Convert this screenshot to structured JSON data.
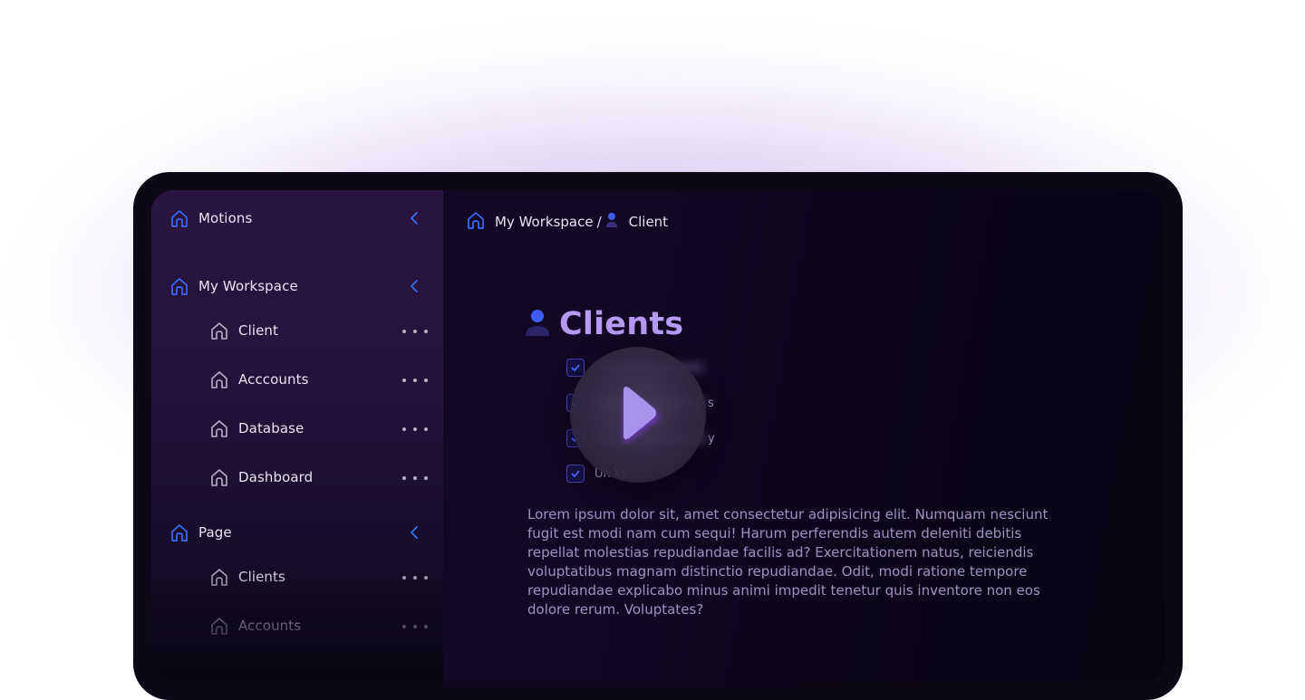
{
  "sidebar": {
    "motions": {
      "label": "Motions"
    },
    "workspace": {
      "label": "My Workspace",
      "items": [
        {
          "label": "Client"
        },
        {
          "label": "Acccounts"
        },
        {
          "label": "Database"
        },
        {
          "label": "Dashboard"
        }
      ]
    },
    "page": {
      "label": "Page",
      "items": [
        {
          "label": "Clients"
        },
        {
          "label": "Accounts"
        }
      ]
    }
  },
  "breadcrumb": {
    "workspace": "My Workspace",
    "separator": "/",
    "current": "Client"
  },
  "main": {
    "title": "Clients",
    "checklist": [
      {
        "label": "",
        "checked": true
      },
      {
        "label": "s",
        "checked": true
      },
      {
        "label": "y",
        "checked": true
      },
      {
        "label": "Un  ks",
        "checked": true
      }
    ],
    "paragraph": "Lorem ipsum dolor sit, amet consectetur adipisicing elit. Numquam nesciunt fugit est modi nam cum sequi! Harum perferendis autem deleniti debitis repellat molestias repudiandae facilis ad? Exercitationem natus, reiciendis voluptatibus magnam distinctio repudiandae. Odit, modi ratione tempore repudiandae explicabo minus animi impedit tenetur quis inventore non eos dolore rerum. Voluptates?"
  },
  "colors": {
    "accent_blue": "#3a6cf5",
    "title_purple": "#b59af0",
    "play_purple": "#a893ec"
  },
  "icons": [
    "house-icon",
    "chevron-left-icon",
    "more-dots-icon",
    "user-icon",
    "checkbox-icon",
    "play-icon"
  ]
}
